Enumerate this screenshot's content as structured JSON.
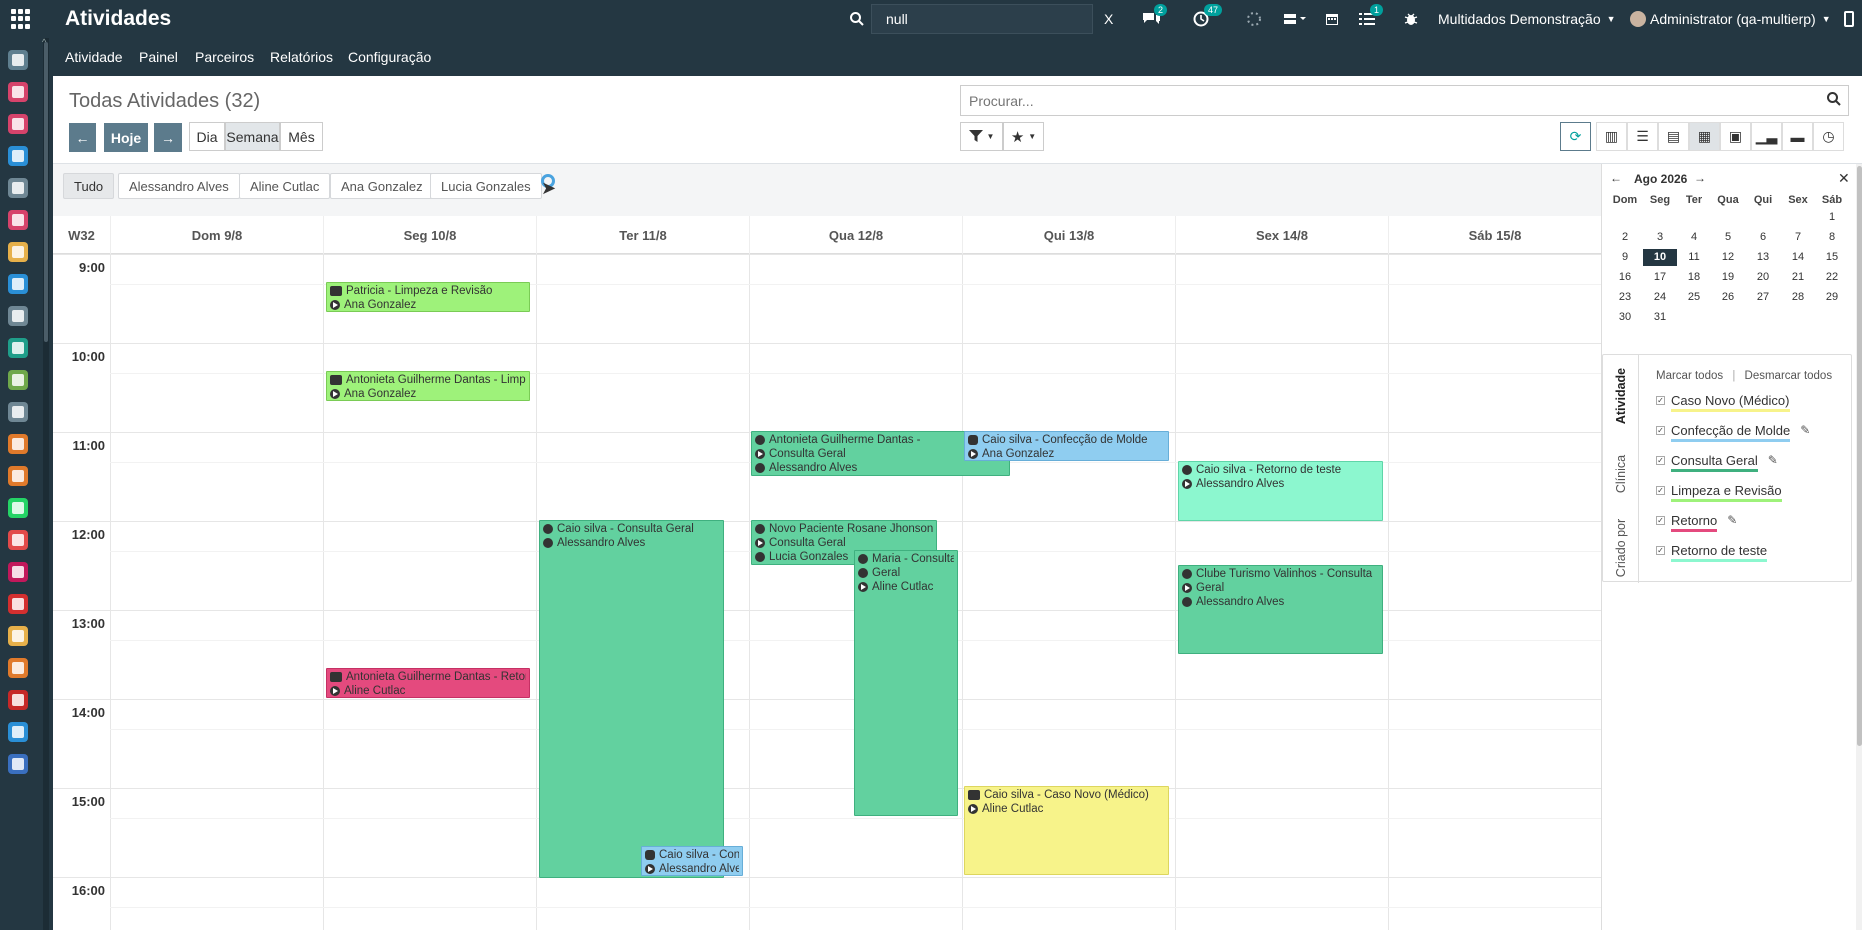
{
  "topbar": {
    "brand": "Atividades",
    "search_value": "null",
    "clear_label": "X",
    "messages_count": "2",
    "activities_count": "47",
    "tasks_count": "1",
    "company": "Multidados Demonstração",
    "user": "Administrator (qa-multierp)"
  },
  "menu": [
    "Atividade",
    "Painel",
    "Parceiros",
    "Relatórios",
    "Configuração"
  ],
  "control": {
    "title": "Todas Atividades (32)",
    "prev": "←",
    "today": "Hoje",
    "next": "→",
    "scales": [
      "Dia",
      "Semana",
      "Mês"
    ],
    "search_placeholder": "Procurar..."
  },
  "chips": [
    "Tudo",
    "Alessandro Alves",
    "Aline Cutlac",
    "Ana Gonzalez",
    "Lucia Gonzales"
  ],
  "calendar": {
    "week": "W32",
    "days": [
      "Dom 9/8",
      "Seg 10/8",
      "Ter 11/8",
      "Qua 12/8",
      "Qui 13/8",
      "Sex 14/8",
      "Sáb 15/8"
    ],
    "hours": [
      "9:00",
      "10:00",
      "11:00",
      "12:00",
      "13:00",
      "14:00",
      "15:00",
      "16:00"
    ],
    "events": [
      {
        "title": "Patricia - Limpeza e Revisão",
        "person": "Ana Gonzalez"
      },
      {
        "title": "Antonieta Guilherme Dantas - Limpeza",
        "person": "Ana Gonzalez"
      },
      {
        "title": "Antonieta Guilherme Dantas -",
        "sub": "Consulta Geral",
        "person": "Alessandro Alves"
      },
      {
        "title": "Caio silva - Confecção de Molde",
        "person": "Ana Gonzalez"
      },
      {
        "title": "Caio silva - Retorno de teste",
        "person": "Alessandro Alves"
      },
      {
        "title": "Caio silva - Consulta Geral",
        "person": "Alessandro Alves"
      },
      {
        "title": "Novo Paciente Rosane Jhonson -",
        "sub": "Consulta Geral",
        "person": "Lucia Gonzales"
      },
      {
        "title": "Maria - Consulta",
        "sub": "Geral",
        "person": "Aline Cutlac"
      },
      {
        "title": "Clube Turismo Valinhos - Consulta",
        "sub": "Geral",
        "person": "Alessandro Alves"
      },
      {
        "title": "Antonieta Guilherme Dantas - Retorno",
        "person": "Aline Cutlac"
      },
      {
        "title": "Caio silva - Caso Novo (Médico)",
        "person": "Aline Cutlac"
      },
      {
        "title": "Caio silva - Confe",
        "person": "Alessandro Alves"
      }
    ]
  },
  "minical": {
    "month": "Ago 2026",
    "weekdays": [
      "Dom",
      "Seg",
      "Ter",
      "Qua",
      "Qui",
      "Sex",
      "Sáb"
    ],
    "today": "10"
  },
  "side_filters": {
    "tabs": [
      "Atividade",
      "Clínica",
      "Criado por"
    ],
    "mark_all": "Marcar todos",
    "separator": "|",
    "unmark_all": "Desmarcar todos",
    "items": [
      {
        "label": "Caso Novo (Médico)",
        "color": "#f7f38a"
      },
      {
        "label": "Confecção de Molde",
        "color": "#8fcdf0"
      },
      {
        "label": "Consulta Geral",
        "color": "#3fb07f"
      },
      {
        "label": "Limpeza e Revisão",
        "color": "#9ef27a"
      },
      {
        "label": "Retorno",
        "color": "#e44a7e"
      },
      {
        "label": "Retorno de teste",
        "color": "#8cf7cf"
      }
    ]
  }
}
